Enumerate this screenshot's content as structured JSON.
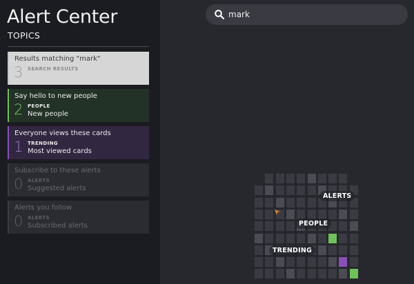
{
  "app": {
    "title": "Alert Center"
  },
  "sidebar": {
    "topics_label": "TOPICS",
    "cards": [
      {
        "title": "Results matching \"mark\"",
        "count": "3",
        "category": "SEARCH RESULTS",
        "subtitle": ""
      },
      {
        "title": "Say hello to new people",
        "count": "2",
        "category": "PEOPLE",
        "subtitle": "New people"
      },
      {
        "title": "Everyone views these cards",
        "count": "1",
        "category": "TRENDING",
        "subtitle": "Most viewed cards"
      },
      {
        "title": "Subscribe to these alerts",
        "count": "0",
        "category": "ALERTS",
        "subtitle": "Suggested alerts"
      },
      {
        "title": "Alerts you follow",
        "count": "0",
        "category": "ALERTS",
        "subtitle": "Subscribed alerts"
      }
    ]
  },
  "search": {
    "value": "mark",
    "icon": "search-icon"
  },
  "map": {
    "labels": {
      "alerts": "ALERTS",
      "people": "PEOPLE",
      "trending": "TRENDING"
    },
    "colors": {
      "people": "#6fc15a",
      "trending": "#8a4fb8",
      "cell_light": "#4a4b53",
      "cell_dark": "#3a3b42"
    }
  }
}
